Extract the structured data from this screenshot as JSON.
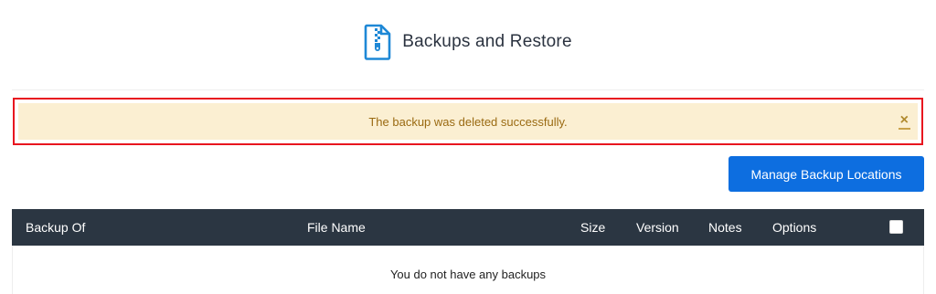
{
  "header": {
    "title": "Backups and Restore",
    "icon": "zip-file-icon",
    "icon_color": "#1e88d6"
  },
  "alert": {
    "message": "The backup was deleted successfully.",
    "close_glyph": "×",
    "bg_color": "#fbefd2",
    "highlight_color": "#e8151f"
  },
  "actions": {
    "manage_locations_label": "Manage Backup Locations",
    "button_color": "#0d6ee0"
  },
  "table": {
    "columns": [
      "Backup Of",
      "File Name",
      "Size",
      "Version",
      "Notes",
      "Options"
    ],
    "header_bg": "#2b3642",
    "empty_message": "You do not have any backups"
  }
}
